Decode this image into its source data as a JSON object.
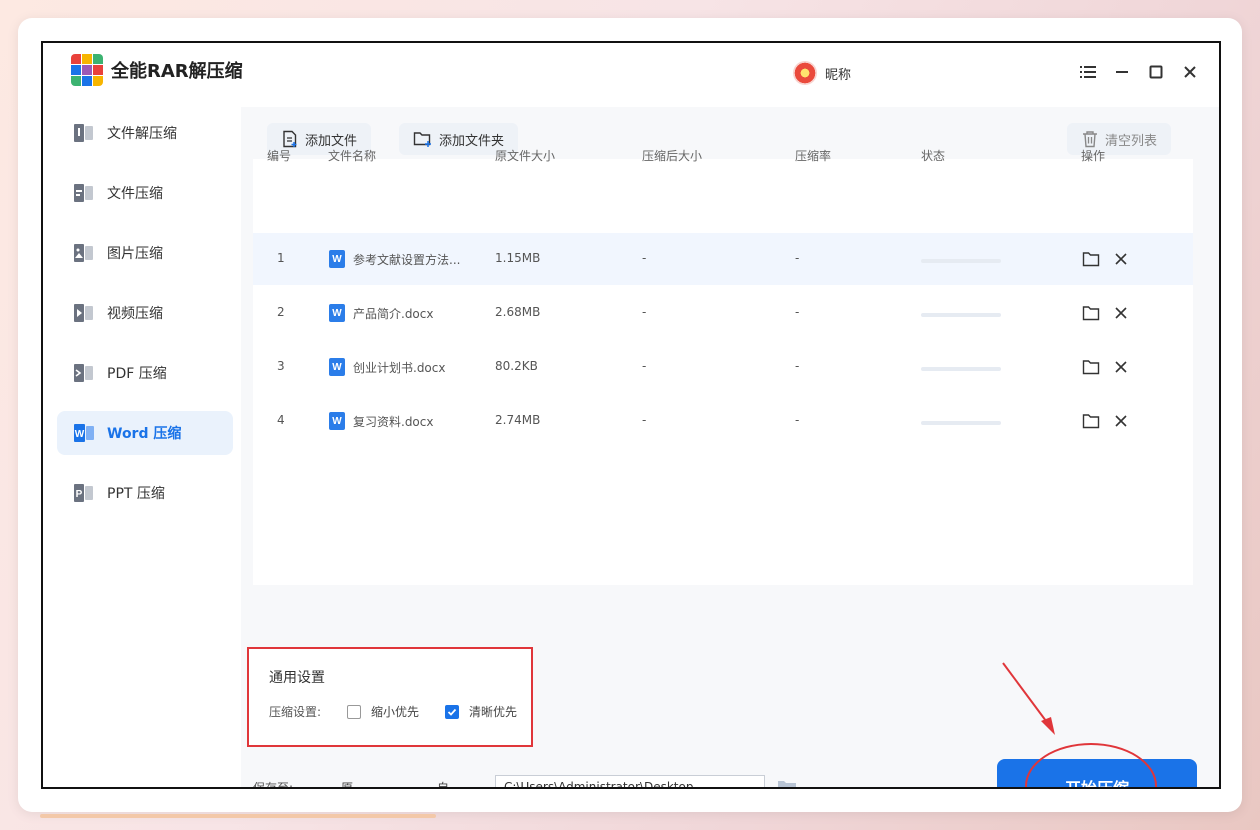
{
  "app": {
    "title": "全能RAR解压缩",
    "user_nickname": "昵称"
  },
  "sidebar": {
    "items": [
      {
        "label": "文件解压缩",
        "icon": "archive-extract-icon"
      },
      {
        "label": "文件压缩",
        "icon": "file-compress-icon"
      },
      {
        "label": "图片压缩",
        "icon": "image-compress-icon"
      },
      {
        "label": "视频压缩",
        "icon": "video-compress-icon"
      },
      {
        "label": "PDF 压缩",
        "icon": "pdf-compress-icon"
      },
      {
        "label": "Word 压缩",
        "icon": "word-compress-icon",
        "active": true
      },
      {
        "label": "PPT 压缩",
        "icon": "ppt-compress-icon"
      }
    ]
  },
  "toolbar": {
    "add_file": "添加文件",
    "add_folder": "添加文件夹",
    "clear_list": "清空列表"
  },
  "table": {
    "headers": [
      "编号",
      "文件名称",
      "原文件大小",
      "压缩后大小",
      "压缩率",
      "状态",
      "操作"
    ],
    "rows": [
      {
        "index": "1",
        "name": "参考文献设置方法...",
        "original_size": "1.15MB",
        "compressed_size": "-",
        "ratio": "-",
        "status_progress": 0
      },
      {
        "index": "2",
        "name": "产品简介.docx",
        "original_size": "2.68MB",
        "compressed_size": "-",
        "ratio": "-",
        "status_progress": 0
      },
      {
        "index": "3",
        "name": "创业计划书.docx",
        "original_size": "80.2KB",
        "compressed_size": "-",
        "ratio": "-",
        "status_progress": 0
      },
      {
        "index": "4",
        "name": "复习资料.docx",
        "original_size": "2.74MB",
        "compressed_size": "-",
        "ratio": "-",
        "status_progress": 0
      }
    ]
  },
  "settings": {
    "title": "通用设置",
    "compress_label": "压缩设置:",
    "options": [
      {
        "label": "缩小优先",
        "checked": false
      },
      {
        "label": "清晰优先",
        "checked": true
      }
    ]
  },
  "save": {
    "label": "保存至:",
    "original_folder": {
      "label": "原文件夹",
      "checked": true
    },
    "custom": {
      "label": "自定义",
      "checked": false
    },
    "path": "C:\\Users\\Administrator\\Desktop"
  },
  "start_button": "开始压缩",
  "colors": {
    "accent": "#1a73e8",
    "annotation": "#e0363a"
  }
}
